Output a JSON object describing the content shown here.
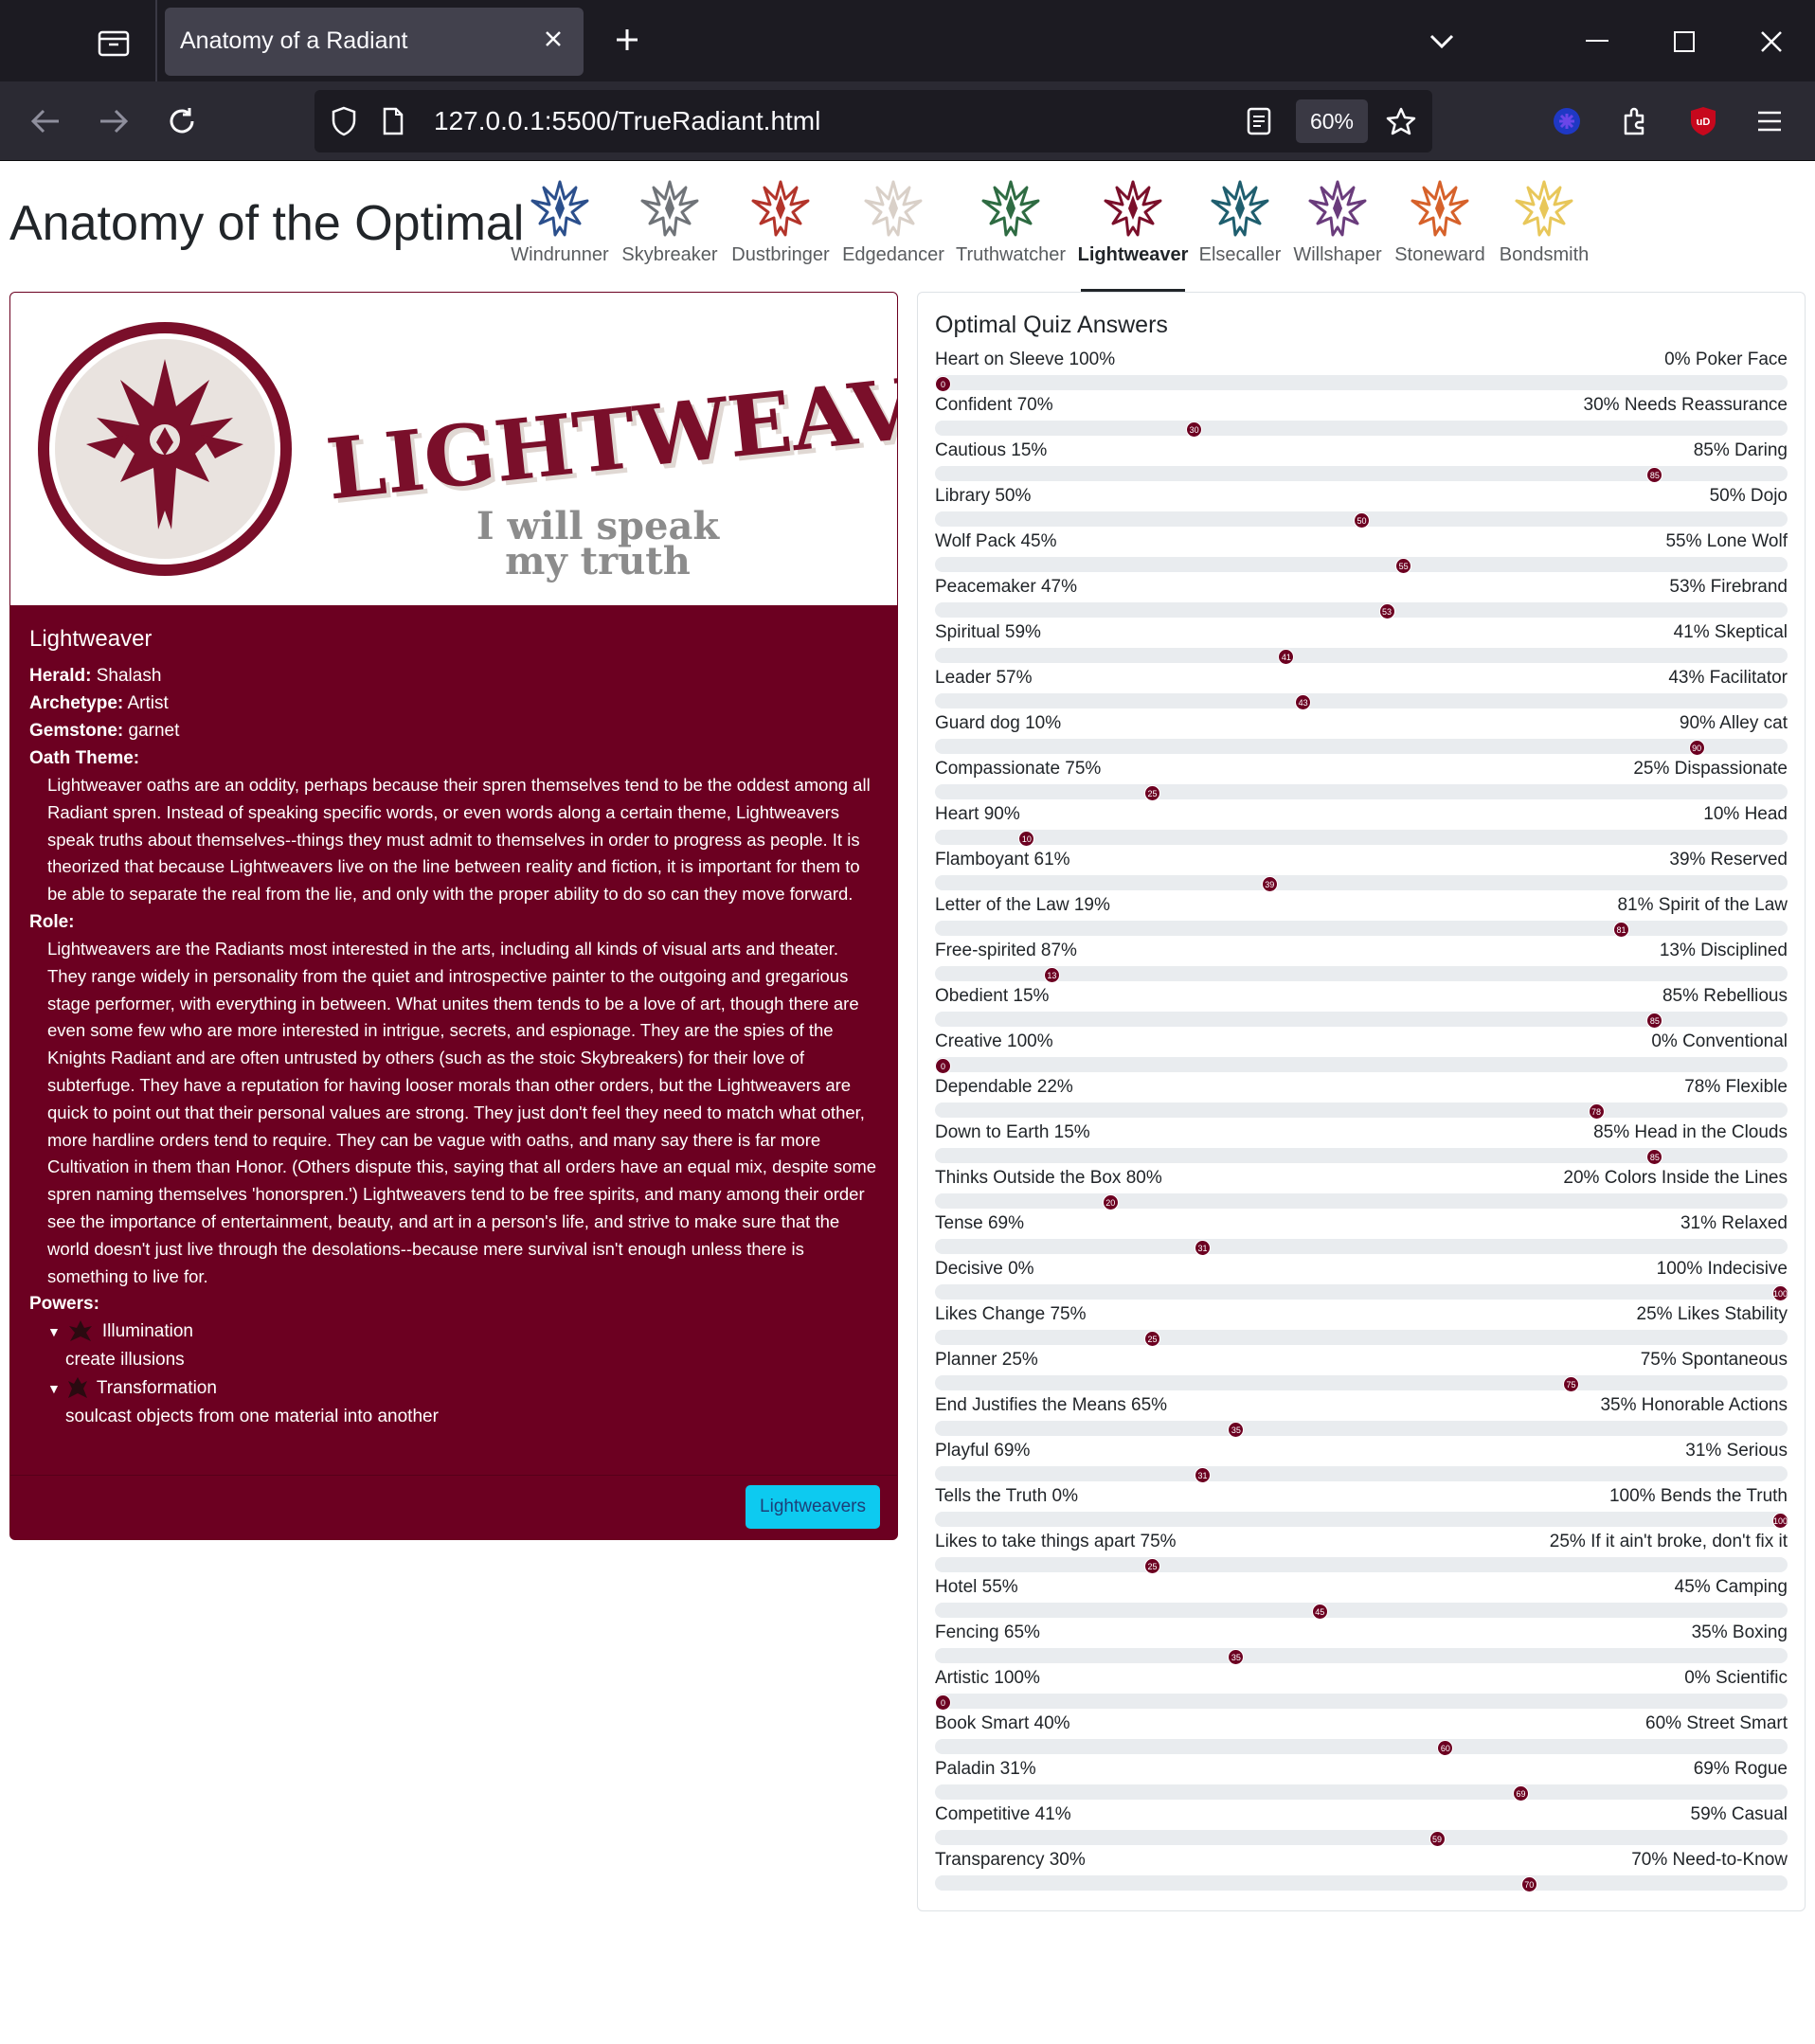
{
  "browser": {
    "tab_title": "Anatomy of a Radiant",
    "url": "127.0.0.1:5500/TrueRadiant.html",
    "zoom": "60%"
  },
  "site": {
    "title": "Anatomy of the Optimal",
    "orders": [
      {
        "name": "Windrunner",
        "color": "#2b4f8c"
      },
      {
        "name": "Skybreaker",
        "color": "#6f7378"
      },
      {
        "name": "Dustbringer",
        "color": "#b3342a"
      },
      {
        "name": "Edgedancer",
        "color": "#d9d0c8"
      },
      {
        "name": "Truthwatcher",
        "color": "#2e6b42"
      },
      {
        "name": "Lightweaver",
        "color": "#7a0f2a",
        "active": true
      },
      {
        "name": "Elsecaller",
        "color": "#1f5e6e"
      },
      {
        "name": "Willshaper",
        "color": "#6a3c7c"
      },
      {
        "name": "Stoneward",
        "color": "#d6612a"
      },
      {
        "name": "Bondsmith",
        "color": "#e8c75a"
      }
    ]
  },
  "card": {
    "banner_word": "LIGHTWEAVER",
    "banner_motto_1": "I will speak",
    "banner_motto_2": "my truth",
    "title": "Lightweaver",
    "herald_label": "Herald:",
    "herald": "Shalash",
    "archetype_label": "Archetype:",
    "archetype": "Artist",
    "gemstone_label": "Gemstone:",
    "gemstone": "garnet",
    "oath_label": "Oath Theme:",
    "oath": "Lightweaver oaths are an oddity, perhaps because their spren themselves tend to be the oddest among all Radiant spren. Instead of speaking specific words, or even words along a certain theme, Lightweavers speak truths about themselves--things they must admit to themselves in order to progress as people. It is theorized that because Lightweavers live on the line between reality and fiction, it is important for them to be able to separate the real from the lie, and only with the proper ability to do so can they move forward.",
    "role_label": "Role:",
    "role": "Lightweavers are the Radiants most interested in the arts, including all kinds of visual arts and theater. They range widely in personality from the quiet and introspective painter to the outgoing and gregarious stage performer, with everything in between. What unites them tends to be a love of art, though there are even some few who are more interested in intrigue, secrets, and espionage. They are the spies of the Knights Radiant and are often untrusted by others (such as the stoic Skybreakers) for their love of subterfuge. They have a reputation for having looser morals than other orders, but the Lightweavers are quick to point out that their personal values are strong. They just don't feel they need to match what other, more hardline orders tend to require. They can be vague with oaths, and many say there is far more Cultivation in them than Honor. (Others dispute this, saying that all orders have an equal mix, despite some spren naming themselves 'honorspren.') Lightweavers tend to be free spirits, and many among their order see the importance of entertainment, beauty, and art in a person's life, and strive to make sure that the world doesn't just live through the desolations--because mere survival isn't enough unless there is something to live for.",
    "powers_label": "Powers:",
    "powers": [
      {
        "name": "Illumination",
        "desc": "create illusions"
      },
      {
        "name": "Transformation",
        "desc": "soulcast objects from one material into another"
      }
    ],
    "footer_button": "Lightweavers",
    "accent": "#6c0021"
  },
  "quiz": {
    "title": "Optimal Quiz Answers",
    "rows": [
      {
        "left": "Heart on Sleeve 100%",
        "right": "0% Poker Face",
        "value": 0
      },
      {
        "left": "Confident 70%",
        "right": "30% Needs Reassurance",
        "value": 30
      },
      {
        "left": "Cautious 15%",
        "right": "85% Daring",
        "value": 85
      },
      {
        "left": "Library 50%",
        "right": "50% Dojo",
        "value": 50
      },
      {
        "left": "Wolf Pack 45%",
        "right": "55% Lone Wolf",
        "value": 55
      },
      {
        "left": "Peacemaker 47%",
        "right": "53% Firebrand",
        "value": 53
      },
      {
        "left": "Spiritual 59%",
        "right": "41% Skeptical",
        "value": 41
      },
      {
        "left": "Leader 57%",
        "right": "43% Facilitator",
        "value": 43
      },
      {
        "left": "Guard dog 10%",
        "right": "90% Alley cat",
        "value": 90
      },
      {
        "left": "Compassionate 75%",
        "right": "25% Dispassionate",
        "value": 25
      },
      {
        "left": "Heart 90%",
        "right": "10% Head",
        "value": 10
      },
      {
        "left": "Flamboyant 61%",
        "right": "39% Reserved",
        "value": 39
      },
      {
        "left": "Letter of the Law 19%",
        "right": "81% Spirit of the Law",
        "value": 81
      },
      {
        "left": "Free-spirited 87%",
        "right": "13% Disciplined",
        "value": 13
      },
      {
        "left": "Obedient 15%",
        "right": "85% Rebellious",
        "value": 85
      },
      {
        "left": "Creative 100%",
        "right": "0% Conventional",
        "value": 0
      },
      {
        "left": "Dependable 22%",
        "right": "78% Flexible",
        "value": 78
      },
      {
        "left": "Down to Earth 15%",
        "right": "85% Head in the Clouds",
        "value": 85
      },
      {
        "left": "Thinks Outside the Box 80%",
        "right": "20% Colors Inside the Lines",
        "value": 20
      },
      {
        "left": "Tense 69%",
        "right": "31% Relaxed",
        "value": 31
      },
      {
        "left": "Decisive 0%",
        "right": "100% Indecisive",
        "value": 100
      },
      {
        "left": "Likes Change 75%",
        "right": "25% Likes Stability",
        "value": 25
      },
      {
        "left": "Planner 25%",
        "right": "75% Spontaneous",
        "value": 75
      },
      {
        "left": "End Justifies the Means 65%",
        "right": "35% Honorable Actions",
        "value": 35
      },
      {
        "left": "Playful 69%",
        "right": "31% Serious",
        "value": 31
      },
      {
        "left": "Tells the Truth 0%",
        "right": "100% Bends the Truth",
        "value": 100
      },
      {
        "left": "Likes to take things apart 75%",
        "right": "25% If it ain't broke, don't fix it",
        "value": 25
      },
      {
        "left": "Hotel 55%",
        "right": "45% Camping",
        "value": 45
      },
      {
        "left": "Fencing 65%",
        "right": "35% Boxing",
        "value": 35
      },
      {
        "left": "Artistic 100%",
        "right": "0% Scientific",
        "value": 0
      },
      {
        "left": "Book Smart 40%",
        "right": "60% Street Smart",
        "value": 60
      },
      {
        "left": "Paladin 31%",
        "right": "69% Rogue",
        "value": 69
      },
      {
        "left": "Competitive 41%",
        "right": "59% Casual",
        "value": 59
      },
      {
        "left": "Transparency 30%",
        "right": "70% Need-to-Know",
        "value": 70
      }
    ]
  }
}
